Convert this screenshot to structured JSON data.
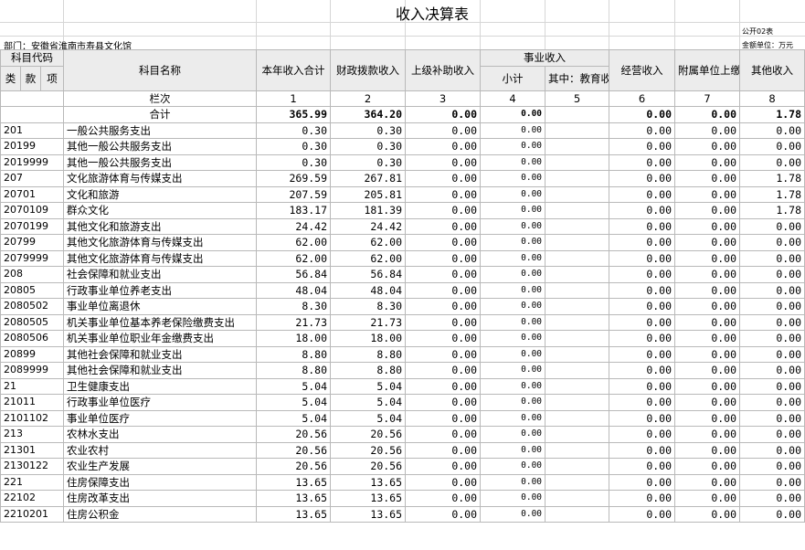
{
  "title": "收入决算表",
  "form_code": "公开02表",
  "department": "部门：安徽省淮南市寿县文化馆",
  "unit": "金额单位：万元",
  "headers": {
    "subject_code": "科目代码",
    "subject_name": "科目名称",
    "total_income": "本年收入合计",
    "fiscal_allocation": "财政拨款收入",
    "superior_subsidy": "上级补助收入",
    "business_income": "事业收入",
    "subtotal": "小计",
    "education_fee": "其中：教育收费",
    "operating_income": "经营收入",
    "affiliated_income": "附属单位上缴收入",
    "other_income": "其他收入",
    "class": "类",
    "section": "款",
    "item": "项",
    "column_no": "栏次"
  },
  "column_numbers": [
    "1",
    "2",
    "3",
    "4",
    "5",
    "6",
    "7",
    "8"
  ],
  "total_row": {
    "label": "合计",
    "values": [
      "365.99",
      "364.20",
      "0.00",
      "0.00",
      "",
      "0.00",
      "0.00",
      "1.78"
    ]
  },
  "rows": [
    {
      "code": "201",
      "name": "一般公共服务支出",
      "values": [
        "0.30",
        "0.30",
        "0.00",
        "0.00",
        "",
        "0.00",
        "0.00",
        "0.00"
      ]
    },
    {
      "code": "20199",
      "name": "其他一般公共服务支出",
      "values": [
        "0.30",
        "0.30",
        "0.00",
        "0.00",
        "",
        "0.00",
        "0.00",
        "0.00"
      ]
    },
    {
      "code": "2019999",
      "name": "其他一般公共服务支出",
      "values": [
        "0.30",
        "0.30",
        "0.00",
        "0.00",
        "",
        "0.00",
        "0.00",
        "0.00"
      ]
    },
    {
      "code": "207",
      "name": "文化旅游体育与传媒支出",
      "values": [
        "269.59",
        "267.81",
        "0.00",
        "0.00",
        "",
        "0.00",
        "0.00",
        "1.78"
      ]
    },
    {
      "code": "20701",
      "name": "文化和旅游",
      "values": [
        "207.59",
        "205.81",
        "0.00",
        "0.00",
        "",
        "0.00",
        "0.00",
        "1.78"
      ]
    },
    {
      "code": "2070109",
      "name": "群众文化",
      "values": [
        "183.17",
        "181.39",
        "0.00",
        "0.00",
        "",
        "0.00",
        "0.00",
        "1.78"
      ]
    },
    {
      "code": "2070199",
      "name": "其他文化和旅游支出",
      "values": [
        "24.42",
        "24.42",
        "0.00",
        "0.00",
        "",
        "0.00",
        "0.00",
        "0.00"
      ]
    },
    {
      "code": "20799",
      "name": "其他文化旅游体育与传媒支出",
      "values": [
        "62.00",
        "62.00",
        "0.00",
        "0.00",
        "",
        "0.00",
        "0.00",
        "0.00"
      ]
    },
    {
      "code": "2079999",
      "name": "其他文化旅游体育与传媒支出",
      "values": [
        "62.00",
        "62.00",
        "0.00",
        "0.00",
        "",
        "0.00",
        "0.00",
        "0.00"
      ]
    },
    {
      "code": "208",
      "name": "社会保障和就业支出",
      "values": [
        "56.84",
        "56.84",
        "0.00",
        "0.00",
        "",
        "0.00",
        "0.00",
        "0.00"
      ]
    },
    {
      "code": "20805",
      "name": "行政事业单位养老支出",
      "values": [
        "48.04",
        "48.04",
        "0.00",
        "0.00",
        "",
        "0.00",
        "0.00",
        "0.00"
      ]
    },
    {
      "code": "2080502",
      "name": "事业单位离退休",
      "values": [
        "8.30",
        "8.30",
        "0.00",
        "0.00",
        "",
        "0.00",
        "0.00",
        "0.00"
      ]
    },
    {
      "code": "2080505",
      "name": "机关事业单位基本养老保险缴费支出",
      "values": [
        "21.73",
        "21.73",
        "0.00",
        "0.00",
        "",
        "0.00",
        "0.00",
        "0.00"
      ]
    },
    {
      "code": "2080506",
      "name": "机关事业单位职业年金缴费支出",
      "values": [
        "18.00",
        "18.00",
        "0.00",
        "0.00",
        "",
        "0.00",
        "0.00",
        "0.00"
      ]
    },
    {
      "code": "20899",
      "name": "其他社会保障和就业支出",
      "values": [
        "8.80",
        "8.80",
        "0.00",
        "0.00",
        "",
        "0.00",
        "0.00",
        "0.00"
      ]
    },
    {
      "code": "2089999",
      "name": "其他社会保障和就业支出",
      "values": [
        "8.80",
        "8.80",
        "0.00",
        "0.00",
        "",
        "0.00",
        "0.00",
        "0.00"
      ]
    },
    {
      "code": "21",
      "name": "卫生健康支出",
      "values": [
        "5.04",
        "5.04",
        "0.00",
        "0.00",
        "",
        "0.00",
        "0.00",
        "0.00"
      ]
    },
    {
      "code": "21011",
      "name": "行政事业单位医疗",
      "values": [
        "5.04",
        "5.04",
        "0.00",
        "0.00",
        "",
        "0.00",
        "0.00",
        "0.00"
      ]
    },
    {
      "code": "2101102",
      "name": "事业单位医疗",
      "values": [
        "5.04",
        "5.04",
        "0.00",
        "0.00",
        "",
        "0.00",
        "0.00",
        "0.00"
      ]
    },
    {
      "code": "213",
      "name": "农林水支出",
      "values": [
        "20.56",
        "20.56",
        "0.00",
        "0.00",
        "",
        "0.00",
        "0.00",
        "0.00"
      ]
    },
    {
      "code": "21301",
      "name": "农业农村",
      "values": [
        "20.56",
        "20.56",
        "0.00",
        "0.00",
        "",
        "0.00",
        "0.00",
        "0.00"
      ]
    },
    {
      "code": "2130122",
      "name": "农业生产发展",
      "values": [
        "20.56",
        "20.56",
        "0.00",
        "0.00",
        "",
        "0.00",
        "0.00",
        "0.00"
      ]
    },
    {
      "code": "221",
      "name": "住房保障支出",
      "values": [
        "13.65",
        "13.65",
        "0.00",
        "0.00",
        "",
        "0.00",
        "0.00",
        "0.00"
      ]
    },
    {
      "code": "22102",
      "name": "住房改革支出",
      "values": [
        "13.65",
        "13.65",
        "0.00",
        "0.00",
        "",
        "0.00",
        "0.00",
        "0.00"
      ]
    },
    {
      "code": "2210201",
      "name": "住房公积金",
      "values": [
        "13.65",
        "13.65",
        "0.00",
        "0.00",
        "",
        "0.00",
        "0.00",
        "0.00"
      ]
    }
  ]
}
